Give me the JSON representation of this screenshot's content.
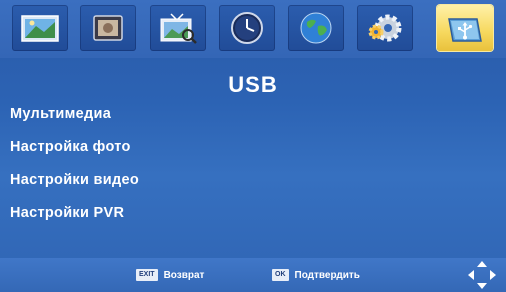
{
  "tabs": [
    {
      "icon": "picture-icon",
      "active": false
    },
    {
      "icon": "photo-frame-icon",
      "active": false
    },
    {
      "icon": "tv-search-icon",
      "active": false
    },
    {
      "icon": "clock-icon",
      "active": false
    },
    {
      "icon": "globe-icon",
      "active": false
    },
    {
      "icon": "settings-gear-icon",
      "active": false
    },
    {
      "icon": "usb-icon",
      "active": true
    }
  ],
  "title": "USB",
  "menu": {
    "items": [
      "Мультимедиа",
      "Настройка фото",
      "Настройки видео",
      "Настройки PVR"
    ]
  },
  "footer": {
    "back_key": "EXIT",
    "back_label": "Возврат",
    "ok_key": "OK",
    "ok_label": "Подтвердить"
  },
  "colors": {
    "background": "#2c63b4",
    "active_tab": "#f6d85d",
    "text": "#ffffff"
  }
}
